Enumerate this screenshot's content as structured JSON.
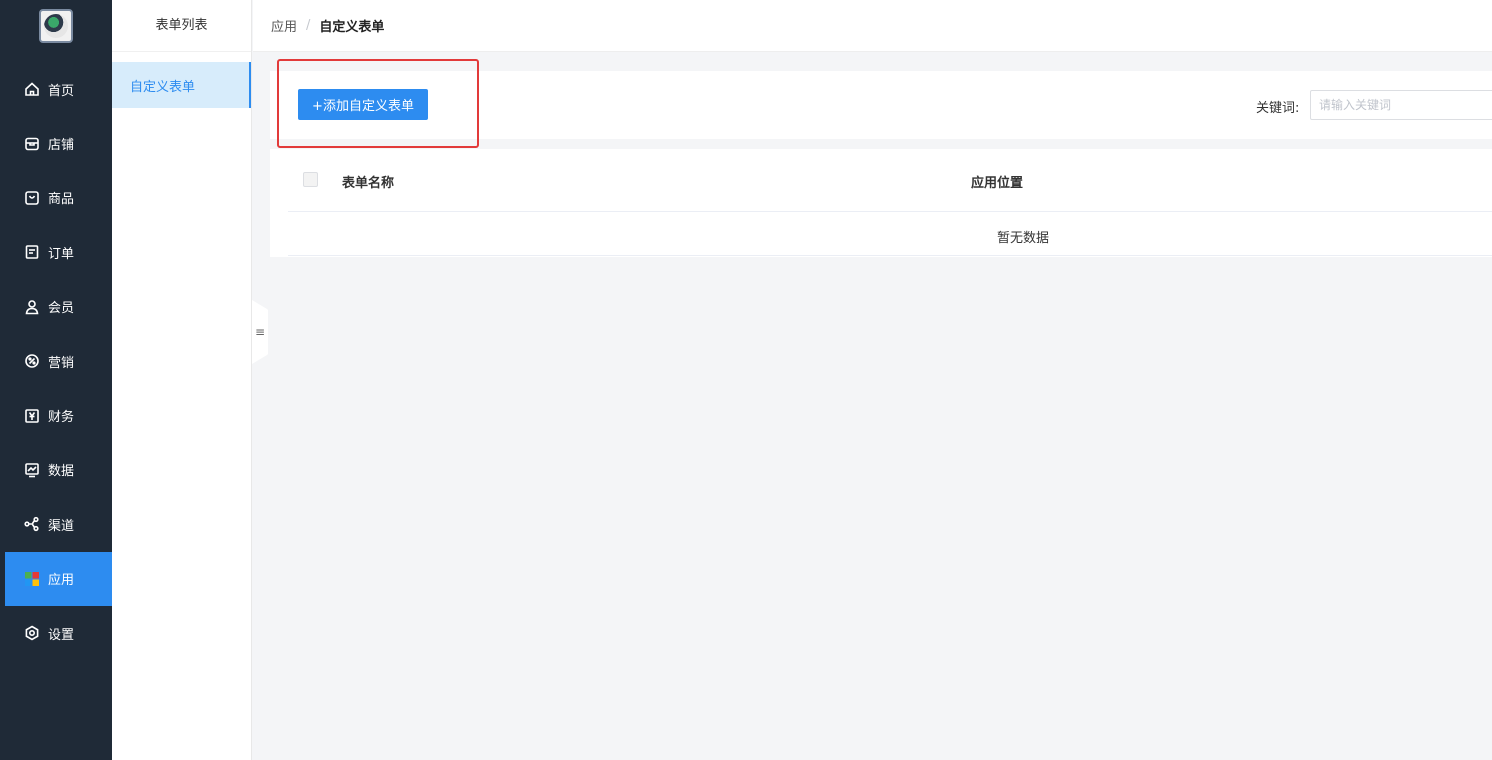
{
  "nav": {
    "items": [
      {
        "label": "首页",
        "icon": "home-icon"
      },
      {
        "label": "店铺",
        "icon": "store-icon"
      },
      {
        "label": "商品",
        "icon": "bag-icon"
      },
      {
        "label": "订单",
        "icon": "order-icon"
      },
      {
        "label": "会员",
        "icon": "user-icon"
      },
      {
        "label": "营销",
        "icon": "marketing-icon"
      },
      {
        "label": "财务",
        "icon": "finance-icon"
      },
      {
        "label": "数据",
        "icon": "chart-icon"
      },
      {
        "label": "渠道",
        "icon": "channel-icon"
      },
      {
        "label": "应用",
        "icon": "apps-icon",
        "active": true
      },
      {
        "label": "设置",
        "icon": "settings-icon"
      }
    ],
    "active_color": "#2d8cf0",
    "bg_color": "#1f2a37"
  },
  "subnav": {
    "title": "表单列表",
    "items": [
      {
        "label": "自定义表单"
      }
    ]
  },
  "breadcrumb": {
    "parent": "应用",
    "separator": "/",
    "current": "自定义表单"
  },
  "toolbar": {
    "add_label": "+添加自定义表单",
    "keyword_label": "关键词:",
    "keyword_placeholder": "请输入关键词",
    "keyword_value": ""
  },
  "table": {
    "columns": [
      "表单名称",
      "应用位置"
    ],
    "empty_text": "暂无数据",
    "rows": []
  },
  "colors": {
    "primary": "#2d8cf0",
    "highlight_border": "#e23a3a"
  }
}
